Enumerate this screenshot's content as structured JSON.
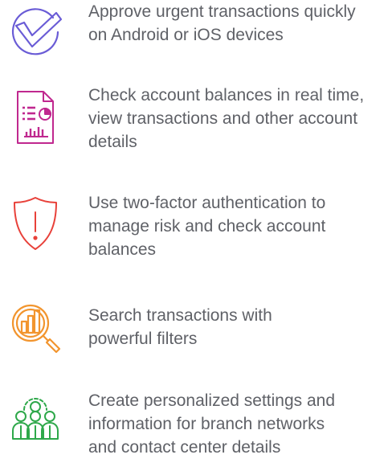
{
  "features": [
    {
      "icon": "checkmark-circle-icon",
      "color": "#6a5cd6",
      "text": "Approve urgent transactions quickly\non Android or iOS devices"
    },
    {
      "icon": "report-document-icon",
      "color": "#c0288f",
      "text": "Check account balances in real time,\nview transactions and other account\ndetails"
    },
    {
      "icon": "shield-alert-icon",
      "color": "#e8413a",
      "text": "Use two-factor authentication to\nmanage risk and check account\nbalances"
    },
    {
      "icon": "chart-search-icon",
      "color": "#f2952e",
      "text": "Search transactions with\npowerful filters"
    },
    {
      "icon": "team-settings-icon",
      "color": "#2ea84a",
      "text": "Create personalized settings and\ninformation for branch networks\nand contact center details"
    }
  ]
}
